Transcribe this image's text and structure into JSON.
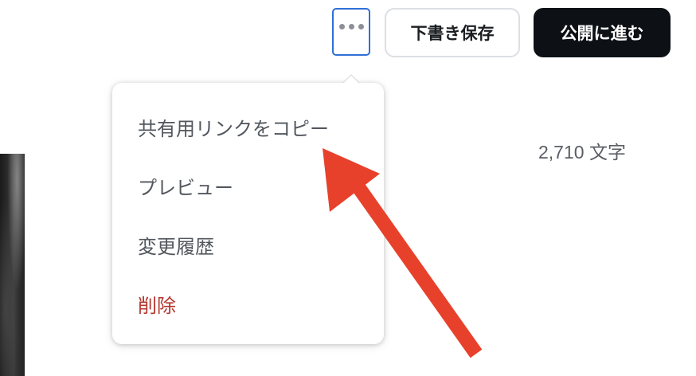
{
  "header": {
    "more_button_icon": "more-horizontal-icon",
    "draft_save_label": "下書き保存",
    "publish_label": "公開に進む"
  },
  "status": {
    "char_count": "2,710 文字"
  },
  "menu": {
    "items": [
      {
        "label": "共有用リンクをコピー"
      },
      {
        "label": "プレビュー"
      },
      {
        "label": "変更履歴"
      },
      {
        "label": "削除",
        "danger": true
      }
    ]
  },
  "colors": {
    "focus_border": "#2f6fd6",
    "publish_bg": "#0d1115",
    "danger_text": "#b3352d",
    "annotation_arrow": "#e8412b"
  }
}
